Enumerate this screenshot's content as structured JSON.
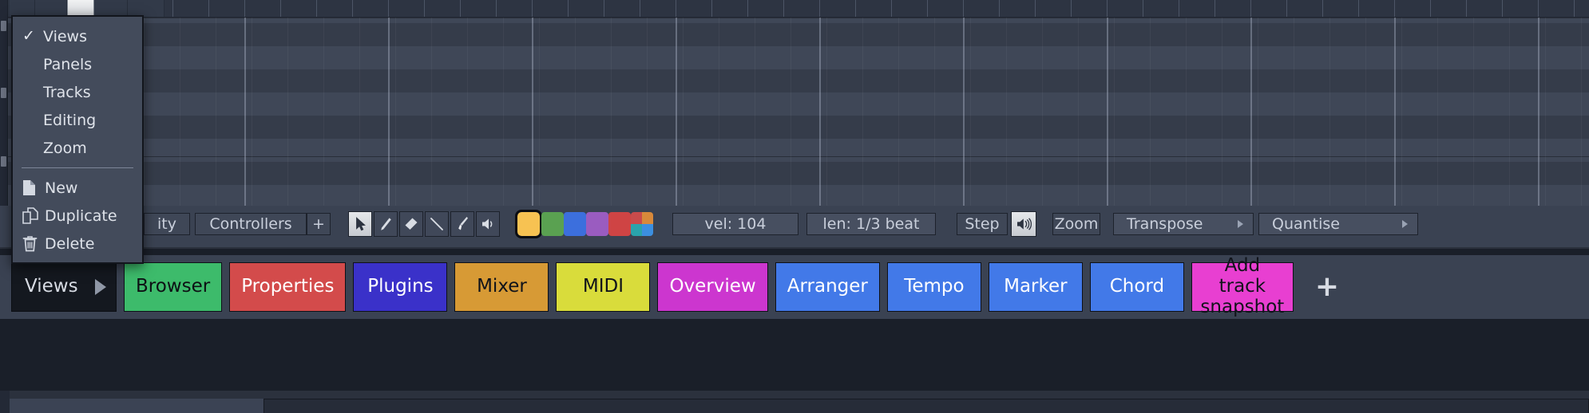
{
  "context_menu": {
    "name": "views-context-menu",
    "items": [
      {
        "label": "Views",
        "icon": "check-icon",
        "checked": true
      },
      {
        "label": "Panels",
        "icon": "none",
        "checked": false
      },
      {
        "label": "Tracks",
        "icon": "none",
        "checked": false
      },
      {
        "label": "Editing",
        "icon": "none",
        "checked": false
      },
      {
        "label": "Zoom",
        "icon": "none",
        "checked": false
      }
    ],
    "actions": [
      {
        "label": "New",
        "icon": "page-icon"
      },
      {
        "label": "Duplicate",
        "icon": "copy-pages-icon"
      },
      {
        "label": "Delete",
        "icon": "trash-icon"
      }
    ],
    "check_glyph": "✓"
  },
  "toolbar": {
    "velocity_tab_label": "ity",
    "controllers_label": "Controllers",
    "add_controller_label": "+",
    "tools": [
      {
        "name": "select-arrow-tool",
        "icon": "cursor-arrow-icon",
        "active": true
      },
      {
        "name": "pencil-tool",
        "icon": "pencil-icon",
        "active": false
      },
      {
        "name": "eraser-tool",
        "icon": "eraser-icon",
        "active": false
      },
      {
        "name": "line-tool",
        "icon": "line-icon",
        "active": false
      },
      {
        "name": "paint-brush-tool",
        "icon": "paint-brush-icon",
        "active": false
      },
      {
        "name": "velocity-tool",
        "icon": "speaker-icon",
        "active": false
      }
    ],
    "colors": [
      {
        "name": "color-swatch-yellow",
        "hex": "#f7c252",
        "selected": true
      },
      {
        "name": "color-swatch-green",
        "hex": "#5aa151",
        "selected": false
      },
      {
        "name": "color-swatch-blue",
        "hex": "#3c6fdd",
        "selected": false
      },
      {
        "name": "color-swatch-purple",
        "hex": "#9a5cc0",
        "selected": false
      },
      {
        "name": "color-swatch-red",
        "hex": "#cf4444",
        "selected": false
      }
    ],
    "multi_color_swatch": {
      "name": "color-swatch-multi",
      "quadrants": [
        "#c94b4b",
        "#d8893a",
        "#2aa3ac",
        "#3c8fe0"
      ]
    },
    "velocity_readout": "vel: 104",
    "length_readout": "len: 1/3 beat",
    "step_label": "Step",
    "step_audition_icon": "speaker-waves-icon",
    "zoom_label": "Zoom",
    "transpose_label": "Transpose",
    "quantise_label": "Quantise"
  },
  "view_bar": {
    "menu_button": {
      "label": "Views",
      "icon": "triangle-right-icon"
    },
    "buttons": [
      {
        "label": "Browser",
        "bg": "#3dbb6b",
        "fg": "#0d1014"
      },
      {
        "label": "Properties",
        "bg": "#d34b4b",
        "fg": "#ffffff"
      },
      {
        "label": "Plugins",
        "bg": "#3a31c9",
        "fg": "#ffffff"
      },
      {
        "label": "Mixer",
        "bg": "#d79a35",
        "fg": "#10131a"
      },
      {
        "label": "MIDI",
        "bg": "#d9dc3b",
        "fg": "#10131a"
      },
      {
        "label": "Overview",
        "bg": "#cc36cf",
        "fg": "#ffffff"
      },
      {
        "label": "Arranger",
        "bg": "#4279e8",
        "fg": "#ffffff"
      },
      {
        "label": "Tempo",
        "bg": "#4279e8",
        "fg": "#ffffff"
      },
      {
        "label": "Marker",
        "bg": "#4279e8",
        "fg": "#ffffff"
      },
      {
        "label": "Chord",
        "bg": "#4279e8",
        "fg": "#ffffff"
      },
      {
        "label": "Add track snapshot",
        "bg": "#e83fd1",
        "fg": "#10131a"
      }
    ],
    "add_button_label": "+"
  },
  "colors": {
    "grid_light_lane": "#3f4757",
    "grid_dark_lane": "#353c4a",
    "toolbar_bg": "#3a4252",
    "menu_bg": "#434b5b",
    "window_bg": "#2b313d",
    "viewbar_bg": "#1a1f29"
  }
}
